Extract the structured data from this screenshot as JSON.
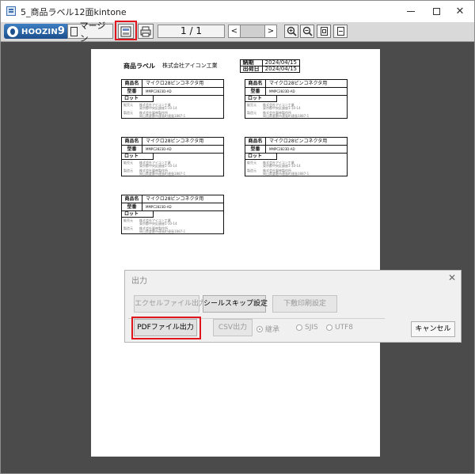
{
  "window": {
    "title": "5_商品ラベル12面kintone",
    "minimize_label": "–",
    "maximize_label": "□",
    "close_label": "✕"
  },
  "toolbar": {
    "logo_text": "HOOZIN",
    "logo_digit": "9",
    "margin_label": "マージン",
    "page_indicator": "1 / 1",
    "prev_label": "<",
    "next_label": ">"
  },
  "document": {
    "header": {
      "title_label": "商品ラベル",
      "company": "株式会社アイコン工業",
      "due_label": "納期",
      "due_value": "2024/04/15",
      "ship_label": "出荷日",
      "ship_value": "2024/04/15"
    },
    "labels": [
      {
        "name_label": "商品名",
        "name_value": "マイクロ28ピンコネクタ用",
        "model_label": "型番",
        "model_value": "MMPC2823D-AD",
        "lot_label": "ロット",
        "seller_label": "販売元",
        "seller_line1": "株式会社アイコン工業",
        "seller_line2": "東京都中央区銀座1-10-14",
        "maker_label": "製造元",
        "maker_line1": "株式会社鳳神製作所",
        "maker_line2": "岡山県倉敷市連島町連島1887-1"
      },
      {
        "name_label": "商品名",
        "name_value": "マイクロ28ピンコネクタ用",
        "model_label": "型番",
        "model_value": "MMPC2823D-AD",
        "lot_label": "ロット",
        "seller_label": "販売元",
        "seller_line1": "株式会社アイコン工業",
        "seller_line2": "東京都中央区銀座1-10-14",
        "maker_label": "製造元",
        "maker_line1": "株式会社鳳神製作所",
        "maker_line2": "岡山県倉敷市連島町連島1887-1"
      },
      {
        "name_label": "商品名",
        "name_value": "マイクロ28ピンコネクタ用",
        "model_label": "型番",
        "model_value": "MMPC2823D-AD",
        "lot_label": "ロット",
        "seller_label": "販売元",
        "seller_line1": "株式会社アイコン工業",
        "seller_line2": "東京都中央区銀座1-10-14",
        "maker_label": "製造元",
        "maker_line1": "株式会社鳳神製作所",
        "maker_line2": "岡山県倉敷市連島町連島1887-1"
      },
      {
        "name_label": "商品名",
        "name_value": "マイクロ28ピンコネクタ用",
        "model_label": "型番",
        "model_value": "MMPC2823D-AD",
        "lot_label": "ロット",
        "seller_label": "販売元",
        "seller_line1": "株式会社アイコン工業",
        "seller_line2": "東京都中央区銀座1-10-14",
        "maker_label": "製造元",
        "maker_line1": "株式会社鳳神製作所",
        "maker_line2": "岡山県倉敷市連島町連島1887-1"
      },
      {
        "name_label": "商品名",
        "name_value": "マイクロ28ピンコネクタ用",
        "model_label": "型番",
        "model_value": "MMPC2823D-AD",
        "lot_label": "ロット",
        "seller_label": "販売元",
        "seller_line1": "株式会社アイコン工業",
        "seller_line2": "東京都中央区銀座1-10-14",
        "maker_label": "製造元",
        "maker_line1": "株式会社鳳神製作所",
        "maker_line2": "岡山県倉敷市連島町連島1887-1"
      }
    ]
  },
  "dialog": {
    "title": "出力",
    "close_label": "✕",
    "excel_button": "エクセルファイル出力",
    "seal_skip_button": "シールスキップ設定",
    "print_setting_button": "下敷印刷設定",
    "pdf_button": "PDFファイル出力",
    "csv_button": "CSV出力",
    "radio_options": [
      "継承",
      "SJIS",
      "UTF8"
    ],
    "selected_option": "継承",
    "cancel_button": "キャンセル"
  },
  "colors": {
    "highlight": "#e0161e",
    "workspace": "#4b4b4b",
    "toolbar": "#d9d9d9"
  }
}
